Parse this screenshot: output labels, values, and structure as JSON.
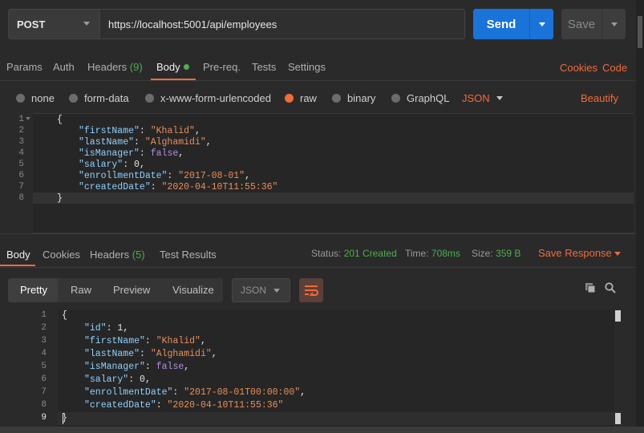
{
  "request": {
    "method": "POST",
    "url": "https://localhost:5001/api/employees",
    "send_label": "Send",
    "save_label": "Save"
  },
  "request_tabs": {
    "params": "Params",
    "auth": "Auth",
    "headers": "Headers",
    "headers_count": "(9)",
    "body": "Body",
    "prereq": "Pre-req.",
    "tests": "Tests",
    "settings": "Settings",
    "cookies": "Cookies",
    "code": "Code"
  },
  "body_types": {
    "none": "none",
    "form_data": "form-data",
    "urlencoded": "x-www-form-urlencoded",
    "raw": "raw",
    "binary": "binary",
    "graphql": "GraphQL",
    "format": "JSON",
    "beautify": "Beautify",
    "selected": "raw"
  },
  "request_body": {
    "line_numbers": [
      "1",
      "2",
      "3",
      "4",
      "5",
      "6",
      "7",
      "8"
    ],
    "open": "{",
    "close": "}",
    "fields": [
      {
        "key": "\"firstName\"",
        "value": "\"Khalid\"",
        "type": "string",
        "sep": ","
      },
      {
        "key": "\"lastName\"",
        "value": "\"Alghamidi\"",
        "type": "string",
        "sep": ","
      },
      {
        "key": "\"isManager\"",
        "value": "false",
        "type": "bool",
        "sep": ","
      },
      {
        "key": "\"salary\"",
        "value": "0",
        "type": "bool",
        "sep": ","
      },
      {
        "key": "\"enrollmentDate\"",
        "value": "\"2017-08-01\"",
        "type": "string",
        "sep": ","
      },
      {
        "key": "\"createdDate\"",
        "value": "\"2020-04-10T11:55:36\"",
        "type": "string",
        "sep": ""
      }
    ]
  },
  "response_tabs": {
    "body": "Body",
    "cookies": "Cookies",
    "headers": "Headers",
    "headers_count": "(5)",
    "test_results": "Test Results"
  },
  "response_status": {
    "status_label": "Status:",
    "status_value": "201 Created",
    "time_label": "Time:",
    "time_value": "708ms",
    "size_label": "Size:",
    "size_value": "359 B",
    "save_response": "Save Response"
  },
  "response_view": {
    "pretty": "Pretty",
    "raw": "Raw",
    "preview": "Preview",
    "visualize": "Visualize",
    "format": "JSON"
  },
  "response_body": {
    "line_numbers": [
      "1",
      "2",
      "3",
      "4",
      "5",
      "6",
      "7",
      "8",
      "9"
    ],
    "open": "{",
    "close": "}",
    "fields": [
      {
        "key": "\"id\"",
        "value": "1",
        "type": "number",
        "sep": ","
      },
      {
        "key": "\"firstName\"",
        "value": "\"Khalid\"",
        "type": "string",
        "sep": ","
      },
      {
        "key": "\"lastName\"",
        "value": "\"Alghamidi\"",
        "type": "string",
        "sep": ","
      },
      {
        "key": "\"isManager\"",
        "value": "false",
        "type": "bool",
        "sep": ","
      },
      {
        "key": "\"salary\"",
        "value": "0",
        "type": "number",
        "sep": ","
      },
      {
        "key": "\"enrollmentDate\"",
        "value": "\"2017-08-01T00:00:00\"",
        "type": "string",
        "sep": ","
      },
      {
        "key": "\"createdDate\"",
        "value": "\"2020-04-10T11:55:36\"",
        "type": "string",
        "sep": ""
      }
    ]
  },
  "colors": {
    "accent": "#f26b3a",
    "send": "#1a73d9",
    "success": "#4caf50"
  },
  "icons": [
    "chevron-down-icon",
    "wrap-lines-icon",
    "copy-icon",
    "search-icon"
  ]
}
